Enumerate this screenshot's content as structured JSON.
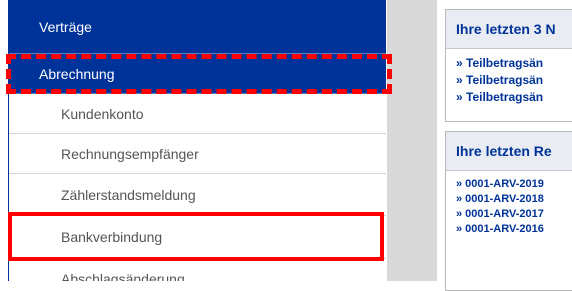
{
  "sidebar": {
    "items": [
      {
        "label": "Verträge",
        "level": "top"
      },
      {
        "label": "Abrechnung",
        "level": "top"
      },
      {
        "label": "Kundenkonto",
        "level": "sub"
      },
      {
        "label": "Rechnungsempfänger",
        "level": "sub"
      },
      {
        "label": "Zählerstandsmeldung",
        "level": "sub"
      },
      {
        "label": "Bankverbindung",
        "level": "sub"
      },
      {
        "label": "Abschlagsänderung",
        "level": "sub"
      }
    ]
  },
  "main": {
    "box1": {
      "title": "Ihre letzten 3 N",
      "links": [
        "» Teilbetragsän",
        "» Teilbetragsän",
        "» Teilbetragsän"
      ]
    },
    "box2": {
      "title": "Ihre letzten Re",
      "links": [
        "» 0001-ARV-2019",
        "» 0001-ARV-2018",
        "» 0001-ARV-2017",
        "» 0001-ARV-2016"
      ]
    }
  },
  "highlights": {
    "color": "#ff0000"
  },
  "colors": {
    "nav_active": "#003399",
    "link": "#003399",
    "gutter": "#d9d9d9"
  }
}
